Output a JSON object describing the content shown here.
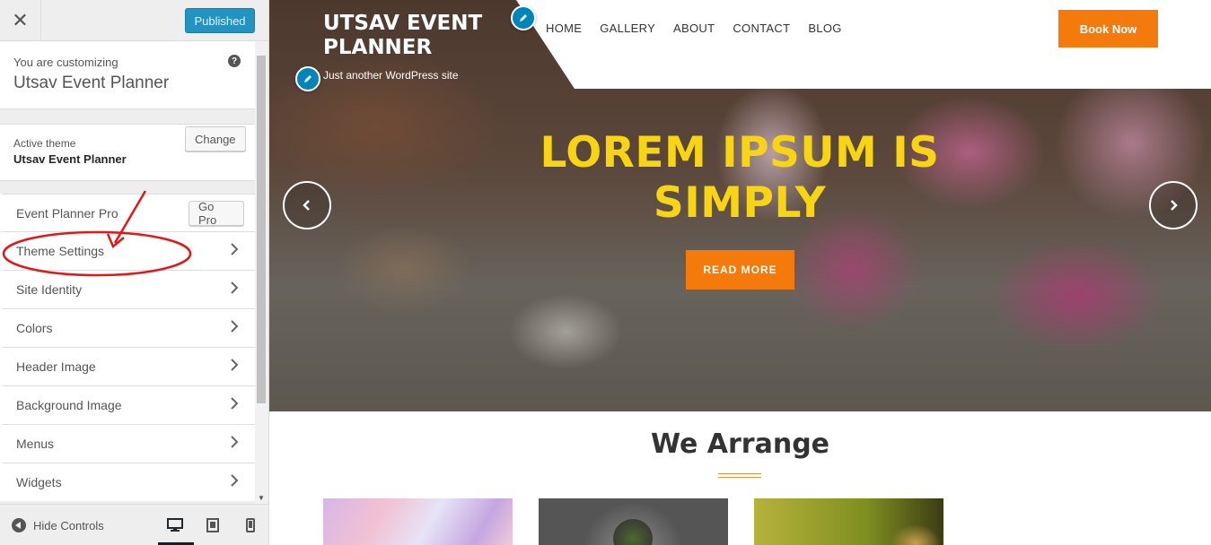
{
  "sidebar": {
    "close_label": "✕",
    "publish_label": "Published",
    "customizing_label": "You are customizing",
    "customizing_title": "Utsav Event Planner",
    "help_label": "?",
    "active_theme_label": "Active theme",
    "active_theme_name": "Utsav Event Planner",
    "change_label": "Change",
    "pro_item_label": "Event Planner Pro",
    "go_pro_label": "Go Pro",
    "items": [
      {
        "label": "Theme Settings"
      },
      {
        "label": "Site Identity"
      },
      {
        "label": "Colors"
      },
      {
        "label": "Header Image"
      },
      {
        "label": "Background Image"
      },
      {
        "label": "Menus"
      },
      {
        "label": "Widgets"
      }
    ],
    "footer": {
      "hide_controls_label": "Hide Controls",
      "devices": [
        "desktop-icon",
        "tablet-icon",
        "mobile-icon"
      ]
    },
    "annotation_color": "#e01818"
  },
  "preview": {
    "site_title": "UTSAV EVENT PLANNER",
    "tagline": "Just another WordPress site",
    "nav": [
      "HOME",
      "GALLERY",
      "ABOUT",
      "CONTACT",
      "BLOG"
    ],
    "book_now_label": "Book Now",
    "slide_heading": "LOREM IPSUM IS SIMPLY",
    "read_more_label": "READ MORE",
    "section_title": "We Arrange",
    "colors": {
      "accent": "#f47a0c",
      "heading_yellow": "#f7d414",
      "wp_blue": "#0085ba"
    }
  }
}
